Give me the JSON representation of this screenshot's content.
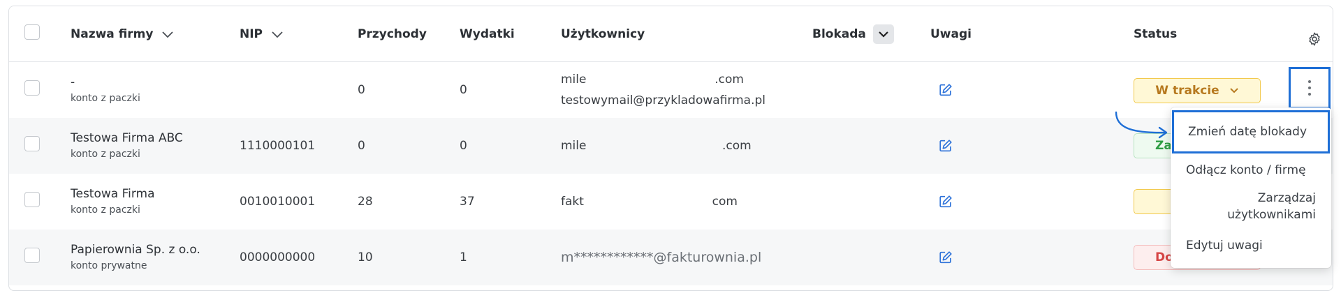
{
  "header": {
    "col_name": "Nazwa firmy",
    "col_nip": "NIP",
    "col_income": "Przychody",
    "col_expenses": "Wydatki",
    "col_users": "Użytkownicy",
    "col_block": "Blokada",
    "col_notes": "Uwagi",
    "col_status": "Status"
  },
  "rows": [
    {
      "name": "-",
      "sub": "konto z paczki",
      "nip": "",
      "income": "0",
      "expenses": "0",
      "user1": "mile                                  .com",
      "user2": "testowymail@przykladowafirma.pl",
      "status": "W trakcie"
    },
    {
      "name": "Testowa Firma ABC",
      "sub": "konto z paczki",
      "nip": "1110000101",
      "income": "0",
      "expenses": "0",
      "user1": "mile                                    .com",
      "status": "Za"
    },
    {
      "name": "Testowa Firma",
      "sub": "konto z paczki",
      "nip": "0010010001",
      "income": "28",
      "expenses": "37",
      "user1": "fakt                                  com",
      "status": ""
    },
    {
      "name": "Papierownia Sp. z o.o.",
      "sub": "konto prywatne",
      "nip": "0000000000",
      "income": "10",
      "expenses": "1",
      "user1": "m************@fakturownia.pl",
      "status": "Do"
    }
  ],
  "menu": {
    "item1": "Zmień datę blokady",
    "item2": "Odłącz konto / firmę",
    "item3_line1": "Zarządzaj",
    "item3_line2": "użytkownikami",
    "item4": "Edytuj uwagi"
  },
  "colors": {
    "accent_blue": "#1f6fd6",
    "status_in_progress_bg": "#fff8d6",
    "status_in_progress_border": "#f2c94c",
    "status_in_progress_text": "#b7791f",
    "status_green_bg": "#eefaf0",
    "status_green_border": "#b7e4c0",
    "status_green_text": "#2f9e44",
    "status_red_bg": "#fdeeee",
    "status_red_border": "#f4bcbc",
    "status_red_text": "#d64545"
  },
  "icons": {
    "sort": "chevron-down-icon",
    "block_toggle": "chevron-down-icon",
    "settings": "gear-icon",
    "notes": "edit-icon",
    "status_dropdown": "chevron-down-icon",
    "row_menu": "kebab-icon",
    "pointer": "curved-arrow-icon"
  }
}
